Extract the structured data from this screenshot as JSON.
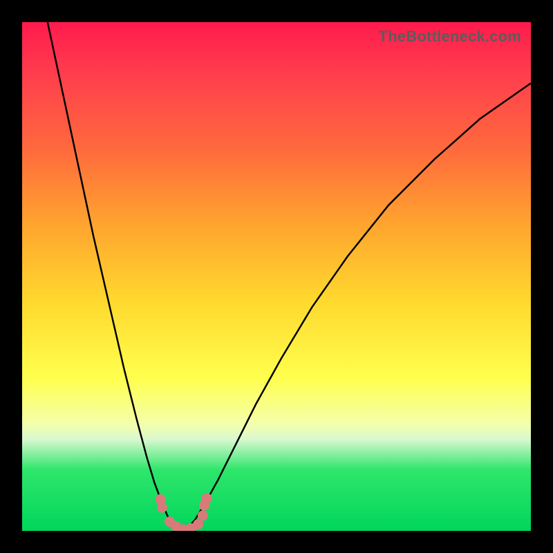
{
  "watermark": "TheBottleneck.com",
  "chart_data": {
    "type": "line",
    "title": "",
    "xlabel": "",
    "ylabel": "",
    "xlim": [
      0,
      100
    ],
    "ylim": [
      0,
      100
    ],
    "series": [
      {
        "name": "left-curve",
        "x": [
          5,
          8,
          11,
          14,
          17,
          20,
          22.5,
          24.5,
          26,
          27.3,
          28.2,
          29,
          30.5,
          32
        ],
        "y": [
          100,
          86,
          72,
          58,
          45,
          32,
          22,
          14.5,
          9.5,
          6,
          3.8,
          2,
          0.6,
          0
        ]
      },
      {
        "name": "right-curve",
        "x": [
          32,
          34,
          36,
          38.5,
          42,
          46,
          51,
          57,
          64,
          72,
          81,
          90,
          100
        ],
        "y": [
          0,
          2.2,
          5.5,
          10,
          17,
          25,
          34,
          44,
          54,
          64,
          73,
          81,
          88
        ]
      }
    ],
    "markers": [
      {
        "x": 27.2,
        "y": 6.2
      },
      {
        "x": 27.5,
        "y": 4.6
      },
      {
        "x": 29.0,
        "y": 1.8
      },
      {
        "x": 30.2,
        "y": 0.9
      },
      {
        "x": 31.6,
        "y": 0.3
      },
      {
        "x": 33.2,
        "y": 0.5
      },
      {
        "x": 34.6,
        "y": 1.3
      },
      {
        "x": 35.5,
        "y": 3.0
      },
      {
        "x": 35.8,
        "y": 5.0
      },
      {
        "x": 36.3,
        "y": 6.4
      }
    ],
    "gradient_stops": [
      {
        "pos": 0,
        "color": "#ff1a4d"
      },
      {
        "pos": 25,
        "color": "#ff6a3d"
      },
      {
        "pos": 55,
        "color": "#ffd92e"
      },
      {
        "pos": 79,
        "color": "#f4ffac"
      },
      {
        "pos": 88,
        "color": "#2ee66b"
      },
      {
        "pos": 100,
        "color": "#00d65b"
      }
    ]
  }
}
